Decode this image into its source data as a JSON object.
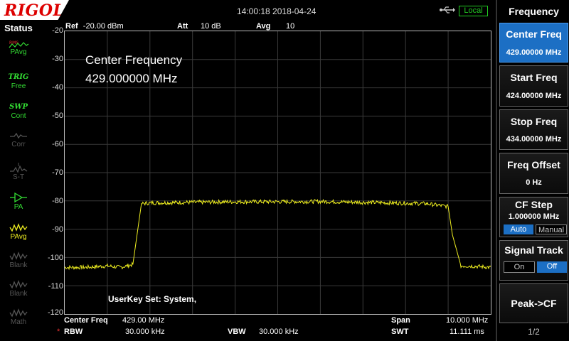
{
  "brand": "RIGOL",
  "datetime": "14:00:18 2018-04-24",
  "remote_status": "Local",
  "status": {
    "title": "Status",
    "items": [
      {
        "top": "RMS",
        "bottom": "PAvg",
        "state": "on",
        "icon": "rms-avg-icon"
      },
      {
        "top": "TRIG",
        "bottom": "Free",
        "state": "on",
        "icon": ""
      },
      {
        "top": "SWP",
        "bottom": "Cont",
        "state": "on",
        "icon": ""
      },
      {
        "top": "",
        "bottom": "Corr",
        "state": "dim",
        "icon": "correction-icon"
      },
      {
        "top": "",
        "bottom": "S-T",
        "state": "dim",
        "icon": "signal-track-icon"
      },
      {
        "top": "",
        "bottom": "PA",
        "state": "on",
        "icon": "preamp-icon"
      },
      {
        "top": "",
        "bottom": "PAvg",
        "state": "on",
        "icon": "trace-avg-icon"
      },
      {
        "top": "",
        "bottom": "Blank",
        "state": "dim",
        "icon": "trace-blank-icon"
      },
      {
        "top": "",
        "bottom": "Blank",
        "state": "dim",
        "icon": "trace-blank-icon"
      },
      {
        "top": "",
        "bottom": "Math",
        "state": "dim",
        "icon": "trace-math-icon"
      }
    ]
  },
  "header": {
    "ref_label": "Ref",
    "ref_value": "-20.00 dBm",
    "att_label": "Att",
    "att_value": "10 dB",
    "avg_label": "Avg",
    "avg_value": "10"
  },
  "overlay": {
    "label": "Center Frequency",
    "value": "429.000000 MHz",
    "userkey": "UserKey Set:   System,"
  },
  "bottom": {
    "center_freq_label": "Center Freq",
    "center_freq_value": "429.00 MHz",
    "span_label": "Span",
    "span_value": "10.000 MHz",
    "rbw_label": "RBW",
    "rbw_value": "30.000 kHz",
    "vbw_label": "VBW",
    "vbw_value": "30.000 kHz",
    "swt_label": "SWT",
    "swt_value": "11.111 ms"
  },
  "menu": {
    "title": "Frequency",
    "center_freq": {
      "label": "Center Freq",
      "value": "429.00000 MHz"
    },
    "start_freq": {
      "label": "Start Freq",
      "value": "424.00000 MHz"
    },
    "stop_freq": {
      "label": "Stop Freq",
      "value": "434.00000 MHz"
    },
    "freq_offset": {
      "label": "Freq Offset",
      "value": "0 Hz"
    },
    "cf_step": {
      "label": "CF Step",
      "value": "1.000000 MHz",
      "opt_a": "Auto",
      "opt_b": "Manual",
      "selected": "Auto"
    },
    "signal_track": {
      "label": "Signal Track",
      "opt_a": "On",
      "opt_b": "Off",
      "selected": "Off"
    },
    "peak_cf": {
      "label": "Peak->CF"
    },
    "page": "1/2"
  },
  "colors": {
    "trace": "#f0f020",
    "accent": "#1c6fc4",
    "status_on": "#33dd33"
  },
  "chart_data": {
    "type": "line",
    "xlim": [
      424.0,
      434.0
    ],
    "ylim": [
      -120,
      -20
    ],
    "yticks": [
      "-20",
      "-30",
      "-40",
      "-50",
      "-60",
      "-70",
      "-80",
      "-90",
      "-100",
      "-110",
      "-120"
    ],
    "grid": true,
    "series": [
      {
        "x": [
          424.0,
          424.5,
          425.0,
          425.3,
          425.6,
          425.8,
          426.0,
          427.0,
          428.0,
          429.0,
          430.0,
          431.0,
          432.0,
          432.5,
          433.0,
          433.1,
          433.3,
          433.5,
          434.0
        ],
        "y": [
          -103.5,
          -103.5,
          -103.0,
          -103.5,
          -102.5,
          -81.0,
          -80.7,
          -80.5,
          -80.3,
          -80.3,
          -80.2,
          -80.5,
          -80.8,
          -81.0,
          -82.0,
          -92.0,
          -103.0,
          -103.0,
          -103.5
        ]
      }
    ]
  }
}
